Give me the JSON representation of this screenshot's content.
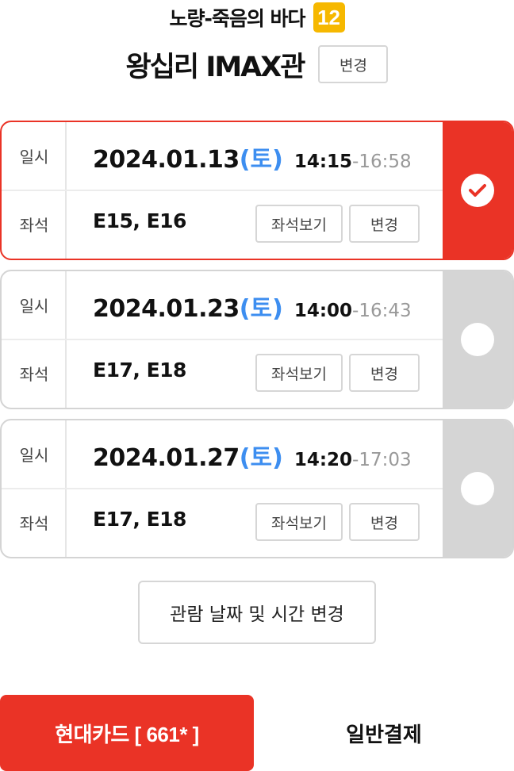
{
  "header": {
    "movie_title": "노량-죽음의 바다",
    "age_rating": "12",
    "theater_name": "왕십리 IMAX관",
    "theater_change_label": "변경"
  },
  "showtimes": [
    {
      "date_label": "일시",
      "date": "2024.01.13",
      "day": "(토)",
      "time_start": "14:15",
      "time_end": "-16:58",
      "seat_label": "좌석",
      "seats": "E15, E16",
      "seat_view_label": "좌석보기",
      "seat_change_label": "변경",
      "selected": true
    },
    {
      "date_label": "일시",
      "date": "2024.01.23",
      "day": "(토)",
      "time_start": "14:00",
      "time_end": "-16:43",
      "seat_label": "좌석",
      "seats": "E17, E18",
      "seat_view_label": "좌석보기",
      "seat_change_label": "변경",
      "selected": false
    },
    {
      "date_label": "일시",
      "date": "2024.01.27",
      "day": "(토)",
      "time_start": "14:20",
      "time_end": "-17:03",
      "seat_label": "좌석",
      "seats": "E17, E18",
      "seat_view_label": "좌석보기",
      "seat_change_label": "변경",
      "selected": false
    }
  ],
  "change_datetime_label": "관람 날짜 및 시간 변경",
  "payment": {
    "card_pay_label": "현대카드 [ 661* ]",
    "normal_pay_label": "일반결제"
  },
  "colors": {
    "accent": "#ea3326",
    "day": "#3d8ef0",
    "age_badge": "#f6b800",
    "inactive_side": "#d5d5d5"
  }
}
